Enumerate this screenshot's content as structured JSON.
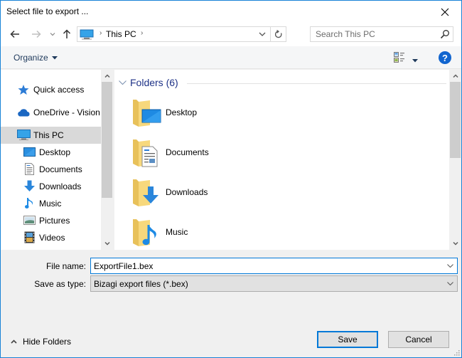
{
  "window": {
    "title": "Select file to export ...",
    "accent_color": "#0078d7"
  },
  "navbar": {
    "back_icon": "arrow-left-icon",
    "forward_icon": "arrow-right-icon",
    "recent_icon": "chevron-down-icon",
    "up_icon": "arrow-up-icon",
    "address": {
      "location_icon": "computer-icon",
      "breadcrumb": [
        "This PC"
      ],
      "refresh_icon": "refresh-icon"
    },
    "search": {
      "placeholder": "Search This PC",
      "value": ""
    }
  },
  "toolbar": {
    "organize_label": "Organize",
    "view_icon": "change-view-icon",
    "help_label": "?"
  },
  "navpane": {
    "items": [
      {
        "label": "Quick access",
        "icon": "star-icon",
        "level": 0,
        "selected": false
      },
      {
        "label": "OneDrive - Vision",
        "icon": "cloud-icon",
        "level": 0,
        "selected": false
      },
      {
        "label": "This PC",
        "icon": "computer-icon",
        "level": 0,
        "selected": true
      },
      {
        "label": "Desktop",
        "icon": "desktop-icon",
        "level": 1,
        "selected": false
      },
      {
        "label": "Documents",
        "icon": "documents-icon",
        "level": 1,
        "selected": false
      },
      {
        "label": "Downloads",
        "icon": "download-icon",
        "level": 1,
        "selected": false
      },
      {
        "label": "Music",
        "icon": "music-icon",
        "level": 1,
        "selected": false
      },
      {
        "label": "Pictures",
        "icon": "pictures-icon",
        "level": 1,
        "selected": false
      },
      {
        "label": "Videos",
        "icon": "videos-icon",
        "level": 1,
        "selected": false
      }
    ]
  },
  "content": {
    "group_title": "Folders (6)",
    "folders": [
      {
        "name": "Desktop",
        "overlay": "desktop"
      },
      {
        "name": "Documents",
        "overlay": "documents"
      },
      {
        "name": "Downloads",
        "overlay": "downloads"
      },
      {
        "name": "Music",
        "overlay": "music"
      }
    ]
  },
  "form": {
    "file_name_label": "File name:",
    "file_name_value": "ExportFile1.bex",
    "save_type_label": "Save as type:",
    "save_type_value": "Bizagi export files (*.bex)"
  },
  "footer": {
    "hide_folders_label": "Hide Folders",
    "save_label": "Save",
    "cancel_label": "Cancel"
  }
}
